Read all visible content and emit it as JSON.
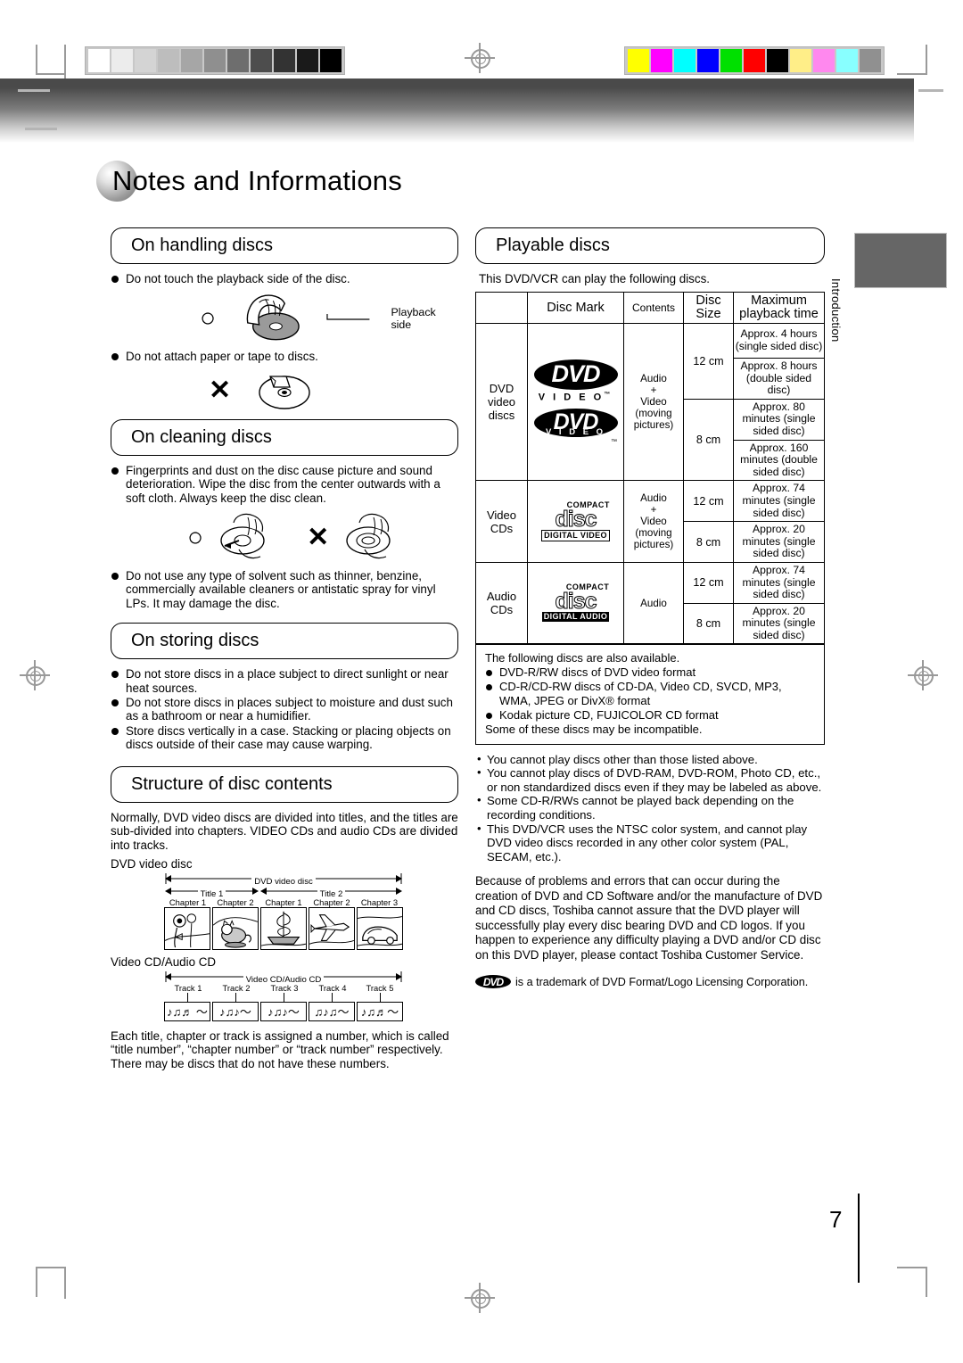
{
  "page": {
    "number": "7",
    "side_tab_label": "Introduction",
    "title": "Notes and Informations"
  },
  "calibration": {
    "gray_steps": [
      "#ffffff",
      "#ececec",
      "#d4d4d4",
      "#bdbdbd",
      "#a6a6a6",
      "#8f8f8f",
      "#6e6e6e",
      "#4d4d4d",
      "#333333",
      "#1a1a1a",
      "#000000"
    ],
    "color_steps": [
      "#ffff00",
      "#ff00ff",
      "#00ffff",
      "#0000ff",
      "#00e000",
      "#ff0000",
      "#000000",
      "#ffee88",
      "#ff88ee",
      "#88ffff",
      "#909090"
    ]
  },
  "left": {
    "handling": {
      "heading": "On handling discs",
      "bullets": [
        "Do not touch the playback side of the disc.",
        "Do not attach paper or tape to discs."
      ],
      "playback_side_label": "Playback side"
    },
    "cleaning": {
      "heading": "On cleaning discs",
      "bullets": [
        "Fingerprints and dust on the disc cause picture and sound deterioration. Wipe the disc from the center outwards with a soft cloth. Always keep the disc clean.",
        "Do not use any type of solvent such as thinner, benzine, commercially available cleaners or antistatic spray for vinyl LPs. It may damage the disc."
      ]
    },
    "storing": {
      "heading": "On storing discs",
      "bullets": [
        "Do not store discs in a place subject to direct sunlight or near heat sources.",
        "Do not store discs in places subject to moisture and dust such as a bathroom or near a humidifier.",
        "Store discs vertically in a case. Stacking or placing objects on discs outside of their case may cause warping."
      ]
    },
    "structure": {
      "heading": "Structure of disc contents",
      "intro": "Normally, DVD video discs are divided into titles, and the titles are sub-divided into chapters. VIDEO CDs and audio CDs are divided into tracks.",
      "dvd_caption": "DVD video disc",
      "dvd_diagram": {
        "span_label": "DVD video disc",
        "titles": [
          {
            "label": "Title 1",
            "chapters": [
              "Chapter 1",
              "Chapter 2"
            ]
          },
          {
            "label": "Title 2",
            "chapters": [
              "Chapter 1",
              "Chapter 2",
              "Chapter 3"
            ]
          }
        ]
      },
      "cd_caption": "Video CD/Audio CD",
      "cd_diagram": {
        "span_label": "Video CD/Audio CD",
        "tracks": [
          "Track 1",
          "Track 2",
          "Track 3",
          "Track 4",
          "Track 5"
        ],
        "track_glyphs": [
          "♪♫♬ 〜",
          "♪♫♪〜",
          "♪♫♪〜",
          "♫♪♫〜",
          "♪♫♬〜"
        ]
      },
      "outro1": "Each title, chapter or track is assigned a number, which is called “title number”, “chapter number” or “track number” respectively.",
      "outro2": "There may be discs that do not have these numbers."
    }
  },
  "right": {
    "playable": {
      "heading": "Playable discs",
      "intro": "This DVD/VCR can play the following discs.",
      "table": {
        "headers": {
          "type": "",
          "mark": "Disc Mark",
          "contents": "Contents",
          "size_l1": "Disc",
          "size_l2": "Size",
          "time_l1": "Maximum",
          "time_l2": "playback time"
        },
        "rows": [
          {
            "type": "DVD video discs",
            "mark": "dvd-video-logo",
            "contents": "Audio + Video (moving pictures)",
            "sizes": [
              {
                "size": "12 cm",
                "times": [
                  "Approx. 4 hours (single sided disc)",
                  "Approx. 8 hours (double sided disc)"
                ]
              },
              {
                "size": "8 cm",
                "times": [
                  "Approx. 80 minutes (single sided disc)",
                  "Approx. 160 minutes (double sided disc)"
                ]
              }
            ]
          },
          {
            "type": "Video CDs",
            "mark": "compact-disc-digital-video-logo",
            "contents": "Audio + Video (moving pictures)",
            "sizes": [
              {
                "size": "12 cm",
                "times": [
                  "Approx. 74 minutes (single sided disc)"
                ]
              },
              {
                "size": "8 cm",
                "times": [
                  "Approx. 20 minutes (single sided disc)"
                ]
              }
            ]
          },
          {
            "type": "Audio CDs",
            "mark": "compact-disc-digital-audio-logo",
            "contents": "Audio",
            "sizes": [
              {
                "size": "12 cm",
                "times": [
                  "Approx. 74 minutes (single sided disc)"
                ]
              },
              {
                "size": "8 cm",
                "times": [
                  "Approx. 20 minutes (single sided disc)"
                ]
              }
            ]
          }
        ]
      },
      "also_box": {
        "lead": "The following discs are also available.",
        "items": [
          "DVD-R/RW discs of DVD video format",
          "CD-R/CD-RW discs of CD-DA, Video CD, SVCD, MP3, WMA, JPEG or DivX® format",
          "Kodak picture CD, FUJICOLOR CD format"
        ],
        "footer": "Some of these discs may be incompatible."
      },
      "notes": [
        "You cannot play discs other than those listed above.",
        "You cannot play discs of DVD-RAM, DVD-ROM, Photo CD, etc., or non standardized discs even if they may be labeled as above.",
        "Some CD-R/RWs cannot be played back depending on the recording conditions.",
        "This DVD/VCR uses the NTSC color system, and cannot play DVD video discs recorded in any other color system (PAL, SECAM, etc.)."
      ],
      "disclaimer": "Because of problems and errors that can occur during the creation of DVD and CD Software and/or the manufacture of DVD and CD discs, Toshiba cannot assure that the DVD player will successfully play every disc bearing DVD and CD logos. If you happen to experience any difficulty playing a DVD and/or CD disc on this DVD player, please contact Toshiba Customer Service.",
      "trademark": "is a trademark of DVD Format/Logo Licensing Corporation."
    }
  }
}
